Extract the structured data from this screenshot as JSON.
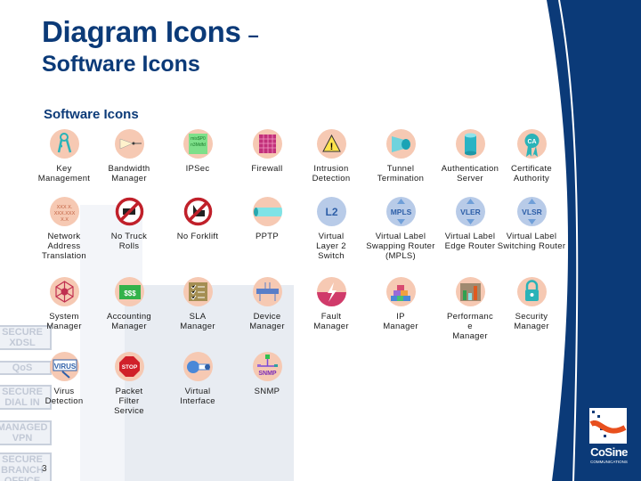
{
  "title": {
    "line1": "Diagram Icons",
    "dash": "–",
    "line2": "Software Icons"
  },
  "section_heading": "Software Icons",
  "page_number": "3",
  "logo": {
    "name": "CoSine",
    "subtitle": "COMMUNICATIONS"
  },
  "background_signs": [
    "SECURE XDSL",
    "QoS",
    "SECURE DIAL IN",
    "MANAGED VPN",
    "SECURE BRANCH OFFICE"
  ],
  "colors": {
    "title": "#0b3a78",
    "sidebar": "#0b3a78",
    "icon_bg": "#f6c9b3",
    "logo_accent": "#e8501e"
  },
  "icons": [
    {
      "icon": "key-icon",
      "label": "Key\nManagement"
    },
    {
      "icon": "bandwidth-icon",
      "label": "Bandwidth\nManager"
    },
    {
      "icon": "ipsec-icon",
      "label": "IPSec"
    },
    {
      "icon": "firewall-icon",
      "label": "Firewall"
    },
    {
      "icon": "warning-icon",
      "label": "Intrusion\nDetection"
    },
    {
      "icon": "tunnel-icon",
      "label": "Tunnel\nTermination"
    },
    {
      "icon": "database-icon",
      "label": "Authentication\nServer"
    },
    {
      "icon": "ribbon-icon",
      "label": "Certificate\nAuthority"
    },
    {
      "icon": "nat-icon",
      "label": "Network\nAddress\nTranslation"
    },
    {
      "icon": "no-truck-icon",
      "label": "No Truck\nRolls"
    },
    {
      "icon": "no-forklift-icon",
      "label": "No Forklift"
    },
    {
      "icon": "pipe-icon",
      "label": "PPTP"
    },
    {
      "icon": "l2-switch-icon",
      "label": "Virtual\nLayer 2\nSwitch"
    },
    {
      "icon": "mpls-icon",
      "label": "Virtual Label\nSwapping Router\n(MPLS)"
    },
    {
      "icon": "vler-icon",
      "label": "Virtual Label\nEdge Router"
    },
    {
      "icon": "vlsr-icon",
      "label": "Virtual Label\nSwitching Router"
    },
    {
      "icon": "network-icon",
      "label": "System\nManager"
    },
    {
      "icon": "money-icon",
      "label": "Accounting\nManager"
    },
    {
      "icon": "checklist-icon",
      "label": "SLA\nManager"
    },
    {
      "icon": "device-icon",
      "label": "Device\nManager"
    },
    {
      "icon": "lightning-icon",
      "label": "Fault\nManager"
    },
    {
      "icon": "blocks-icon",
      "label": "IP\nManager"
    },
    {
      "icon": "bar-chart-icon",
      "label": "Performanc\ne\nManager"
    },
    {
      "icon": "padlock-icon",
      "label": "Security\nManager"
    },
    {
      "icon": "virus-icon",
      "label": "Virus\nDetection"
    },
    {
      "icon": "stop-sign-icon",
      "label": "Packet\nFilter\nService"
    },
    {
      "icon": "interface-icon",
      "label": "Virtual\nInterface"
    },
    {
      "icon": "snmp-icon",
      "label": "SNMP"
    }
  ],
  "icon_texts": {
    "ipsec": "mis$P0",
    "l2": "L2",
    "mpls": "MPLS",
    "vler": "VLER",
    "vlsr": "VLSR",
    "stop": "STOP",
    "virus": "VIRUS",
    "snmp": "SNMP",
    "money": "$$$",
    "ca": "CA"
  }
}
